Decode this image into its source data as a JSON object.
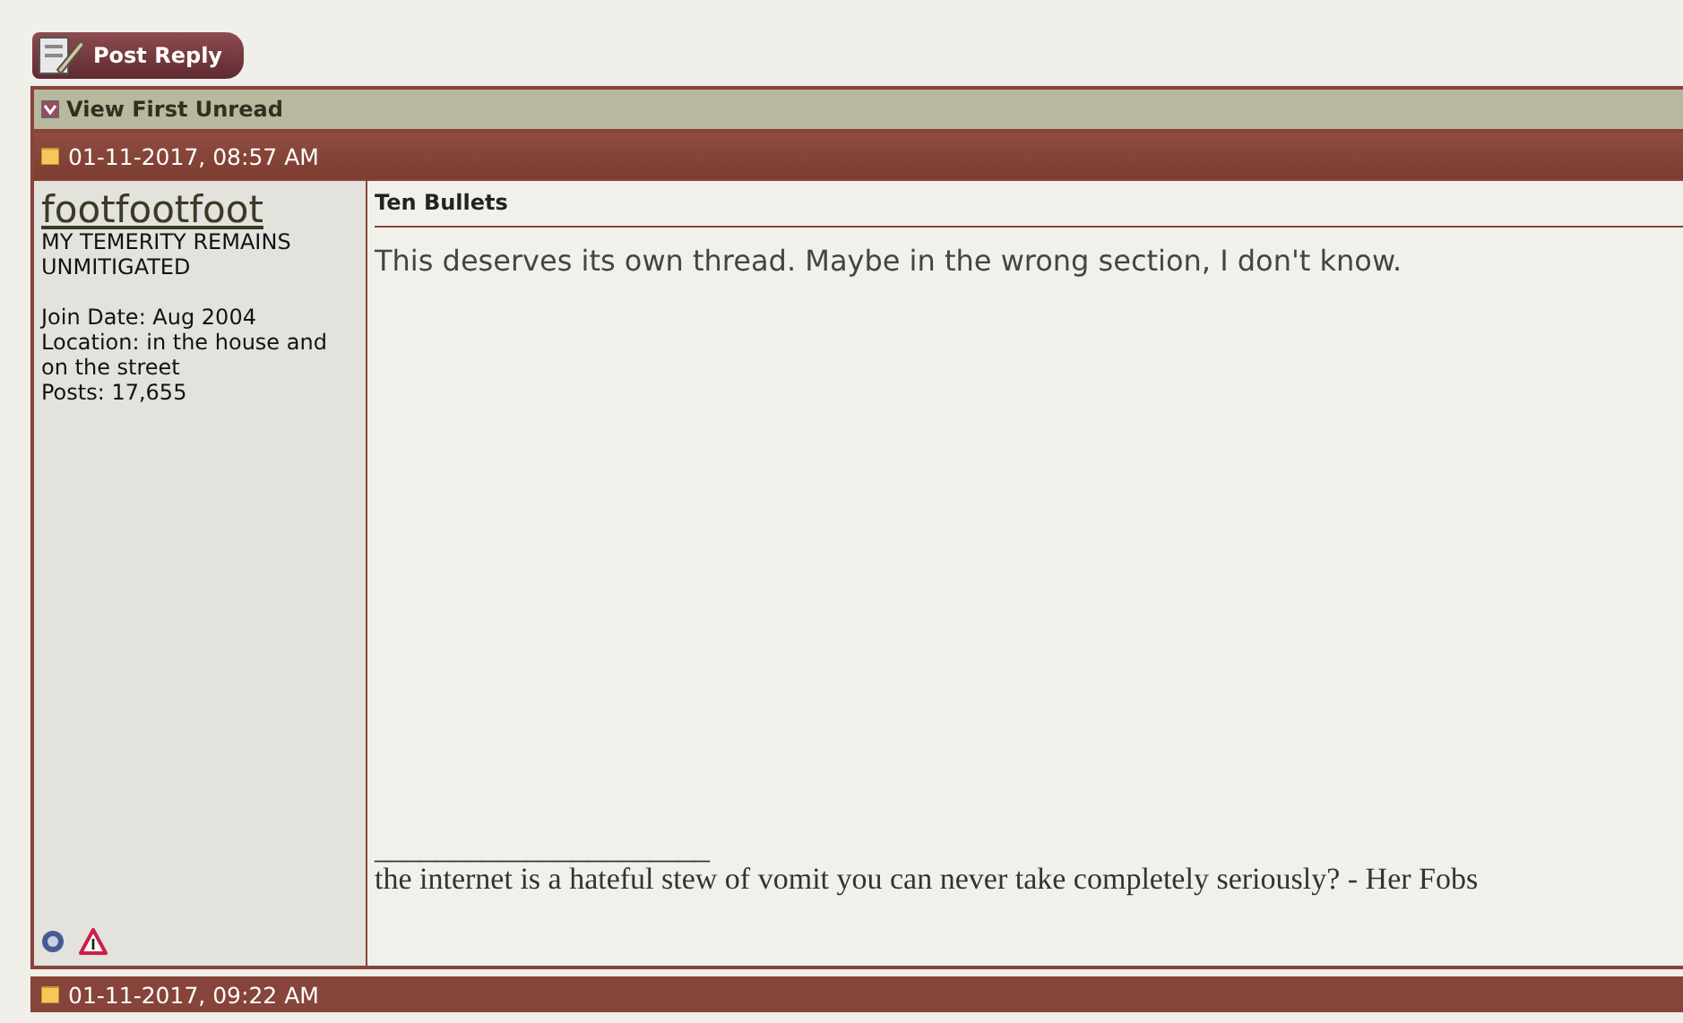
{
  "post_reply_button": {
    "label": "Post Reply"
  },
  "view_first_unread": {
    "label": "View First Unread"
  },
  "posts": [
    {
      "date": "01-11-2017, 08:57 AM",
      "username": "footfootfoot",
      "user_title": "MY TEMERITY REMAINS UNMITIGATED",
      "join_date": "Join Date: Aug 2004",
      "location": "Location: in the house and on the street",
      "post_count": "Posts: 17,655",
      "title": "Ten Bullets",
      "message": "This deserves its own thread. Maybe in the wrong section, I don't know.",
      "signature_rule": "______________________",
      "signature": "the internet is a hateful stew of vomit you can never take completely seriously? - Her Fobs"
    }
  ],
  "next_post": {
    "date": "01-11-2017, 09:22 AM"
  }
}
